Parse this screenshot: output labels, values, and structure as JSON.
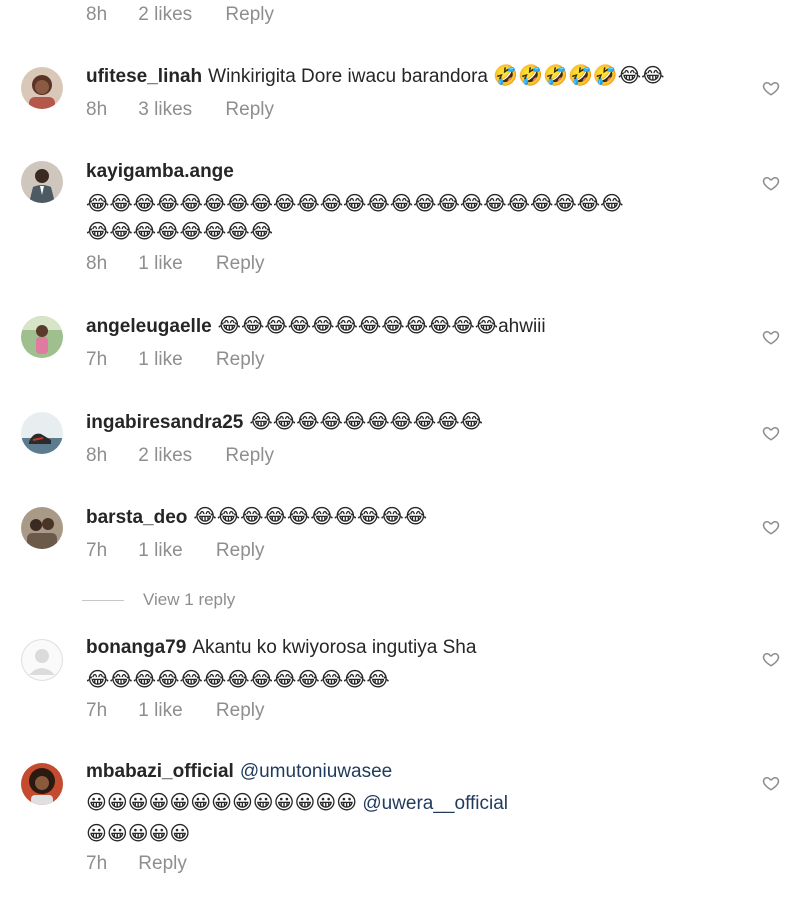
{
  "top_meta": {
    "time": "8h",
    "likes": "2 likes",
    "reply": "Reply"
  },
  "comments": [
    {
      "username": "ufitese_linah",
      "text": "Winkirigita Dore iwacu barandora",
      "emoji_lines": [
        "🤣🤣🤣🤣🤣😂😂"
      ],
      "time": "8h",
      "likes": "3 likes",
      "reply": "Reply",
      "avatar": "avatar-woman-icon",
      "avatar_color": "#b5574b"
    },
    {
      "username": "kayigamba.ange",
      "text": "",
      "emoji_lines": [
        "😂😂😂😂😂😂😂😂😂😂😂😂😂😂😂😂😂😂😂😂😂😂😂",
        "😂😂😂😂😂😂😂😂"
      ],
      "time": "8h",
      "likes": "1 like",
      "reply": "Reply",
      "avatar": "avatar-man-suit-icon",
      "avatar_color": "#4b5a63"
    },
    {
      "username": "angeleugaelle",
      "text": "",
      "emoji_lines": [
        "😂😂😂😂😂😂😂😂😂😂😂😂"
      ],
      "suffix": "ahwiii",
      "time": "7h",
      "likes": "1 like",
      "reply": "Reply",
      "avatar": "avatar-person-outdoor-icon",
      "avatar_color": "#7aa27a"
    },
    {
      "username": "ingabiresandra25",
      "text": "",
      "emoji_lines": [
        "😂😂😂😂😂😂😂😂😂😂"
      ],
      "time": "8h",
      "likes": "2 likes",
      "reply": "Reply",
      "avatar": "avatar-shoes-icon",
      "avatar_color": "#5d7b8f"
    },
    {
      "username": "barsta_deo",
      "text": "",
      "emoji_lines": [
        "😂😂😂😂😂😂😂😂😂😂"
      ],
      "time": "7h",
      "likes": "1 like",
      "reply": "Reply",
      "avatar": "avatar-group-icon",
      "avatar_color": "#6b5a4a"
    },
    {
      "username": "bonanga79",
      "text": "Akantu ko kwiyorosa ingutiya Sha",
      "emoji_lines": [
        "😂😂😂😂😂😂😂😂😂😂😂😂😂"
      ],
      "time": "7h",
      "likes": "1 like",
      "reply": "Reply",
      "avatar": "default-avatar-icon",
      "avatar_color": "#dbdbdb"
    },
    {
      "username": "mbabazi_official",
      "text": "",
      "mention": "@umutoniuwasee",
      "emoji_lines": [
        "😀😀😀😀😀😀😀😀😀😀😀😀😀",
        "😀😀😀😀😀"
      ],
      "inline_mention": "@uwera__official",
      "time": "7h",
      "likes": "",
      "reply": "Reply",
      "avatar": "avatar-woman-curly-icon",
      "avatar_color": "#3a2418"
    }
  ],
  "view_replies": "View 1 reply",
  "colors": {
    "text": "#262626",
    "meta": "#8e8e8e",
    "mention": "#1f3a5c",
    "heart": "#8e8e8e"
  }
}
